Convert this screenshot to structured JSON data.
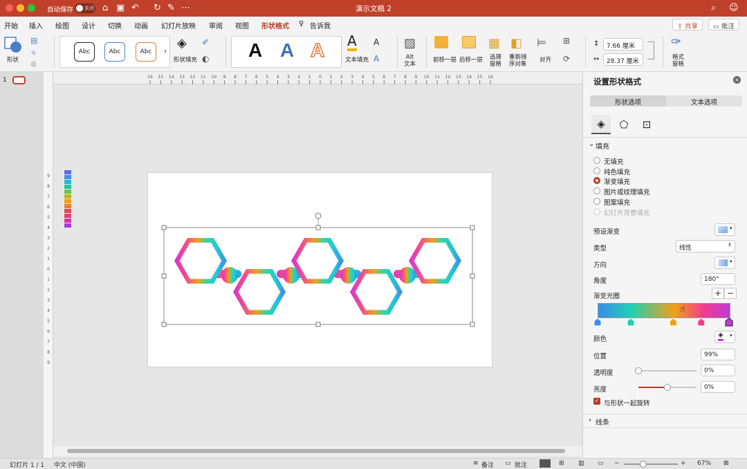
{
  "window": {
    "title": "演示文稿 2",
    "autosave_label": "自动保存",
    "autosave_state": "关闭",
    "traffic_colors": [
      "#fc5f57",
      "#fdbc2e",
      "#27c840"
    ]
  },
  "menu": {
    "tabs": [
      "开始",
      "插入",
      "绘图",
      "设计",
      "切换",
      "动画",
      "幻灯片放映",
      "审阅",
      "视图",
      "形状格式"
    ],
    "active_tab": "形状格式",
    "tell_me": "告诉我",
    "share": "共享",
    "comments": "批注"
  },
  "ribbon": {
    "shape_label": "形状",
    "style_samples": [
      "Abc",
      "Abc",
      "Abc"
    ],
    "shape_fill": "形状填充",
    "wordart": [
      "A",
      "A",
      "A"
    ],
    "text_fill": "文本填充",
    "alt_text": "Alt\n文本",
    "bring_forward": "前移一层",
    "send_backward": "后移一层",
    "selection_pane": "选择\n窗格",
    "reorder": "重新排\n序对象",
    "align": "对齐",
    "height": "7.66 厘米",
    "width": "28.37 厘米",
    "format_pane": "格式\n窗格"
  },
  "ruler": {
    "h_ticks": [
      "16",
      "15",
      "14",
      "13",
      "12",
      "11",
      "10",
      "9",
      "8",
      "7",
      "6",
      "5",
      "4",
      "3",
      "2",
      "1",
      "0",
      "1",
      "2",
      "3",
      "4",
      "5",
      "6",
      "7",
      "8",
      "9",
      "10",
      "11",
      "12",
      "13",
      "14",
      "15",
      "16"
    ],
    "v_ticks": [
      "9",
      "8",
      "7",
      "6",
      "5",
      "4",
      "3",
      "2",
      "1",
      "0",
      "1",
      "2",
      "3",
      "4",
      "5",
      "6",
      "7",
      "8",
      "9"
    ]
  },
  "thumbnails": {
    "slide_number": "1"
  },
  "panel": {
    "title": "设置形状格式",
    "tabs": [
      "形状选项",
      "文本选项"
    ],
    "fill_section": "填充",
    "fill_options": [
      "无填充",
      "纯色填充",
      "渐变填充",
      "图片或纹理填充",
      "图案填充",
      "幻灯片背景填充"
    ],
    "fill_selected": "渐变填充",
    "preset_gradient": "预设渐变",
    "type_label": "类型",
    "type_value": "线性",
    "direction_label": "方向",
    "angle_label": "角度",
    "angle_value": "180°",
    "stops_label": "渐变光圈",
    "color_label": "颜色",
    "position_label": "位置",
    "position_value": "99%",
    "transparency_label": "透明度",
    "transparency_value": "0%",
    "brightness_label": "亮度",
    "brightness_value": "0%",
    "rotate_with_shape": "与形状一起旋转",
    "line_section": "线条",
    "gradient_stops_colors": [
      "#3b8de8",
      "#1fd1b4",
      "#f0a017",
      "#f23c8e",
      "#c23ad6"
    ],
    "transparency_level": 0,
    "brightness_level": 0.5
  },
  "status": {
    "slide_info": "幻灯片 1 / 1",
    "language": "中文 (中国)",
    "notes": "备注",
    "comments": "批注",
    "zoom": "67%"
  }
}
